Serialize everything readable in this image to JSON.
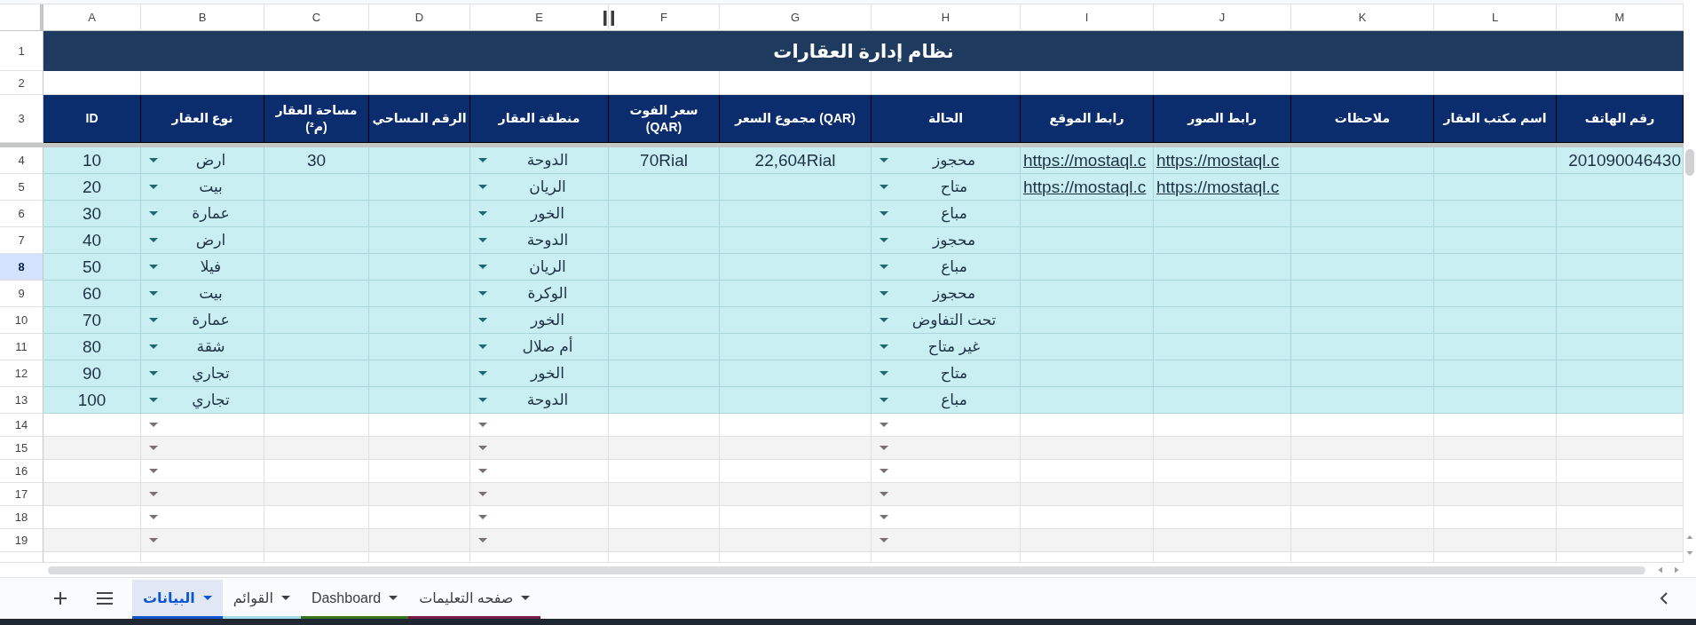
{
  "columns": [
    {
      "letter": "M",
      "kind": "phone",
      "heading": "رقم الهاتف"
    },
    {
      "letter": "L",
      "kind": "text",
      "heading": "اسم مكتب العقار"
    },
    {
      "letter": "K",
      "kind": "text",
      "heading": "ملاحظات"
    },
    {
      "letter": "J",
      "kind": "link",
      "heading": "رابط الصور"
    },
    {
      "letter": "I",
      "kind": "link",
      "heading": "رابط الموقع"
    },
    {
      "letter": "H",
      "kind": "dropdown",
      "heading": "الحالة"
    },
    {
      "letter": "G",
      "kind": "text",
      "heading": "مجموع السعر (QAR)"
    },
    {
      "letter": "F",
      "kind": "text",
      "heading": "سعر الفوت (QAR)"
    },
    {
      "letter": "E",
      "kind": "dropdown",
      "heading": "منطقة العقار"
    },
    {
      "letter": "D",
      "kind": "text",
      "heading": "الرقم المساحي"
    },
    {
      "letter": "C",
      "kind": "number",
      "heading": "مساحة العقار (م²)"
    },
    {
      "letter": "B",
      "kind": "dropdown",
      "heading": "نوع العقار"
    },
    {
      "letter": "A",
      "kind": "number",
      "heading": "ID"
    }
  ],
  "rows": [
    {
      "number": "1",
      "kind": "title",
      "selected": false,
      "title": "نظام إدارة العقارات"
    },
    {
      "number": "2",
      "kind": "spacer",
      "selected": false
    },
    {
      "number": "3",
      "kind": "header",
      "selected": false
    },
    {
      "number": "4",
      "kind": "data",
      "selected": false,
      "values": {
        "id": "10",
        "type": "ارض",
        "area": "30",
        "region": "الدوحة",
        "foot_price": "70Rial",
        "total_price": "22,604Rial",
        "status": "محجوز",
        "site_link": "https://mostaql.c",
        "photos_link": "https://mostaql.c",
        "phone": "201090046430"
      }
    },
    {
      "number": "5",
      "kind": "data",
      "selected": false,
      "values": {
        "id": "20",
        "type": "بيت",
        "region": "الريان",
        "status": "متاح",
        "site_link": "https://mostaql.c",
        "photos_link": "https://mostaql.c"
      }
    },
    {
      "number": "6",
      "kind": "data",
      "selected": false,
      "values": {
        "id": "30",
        "type": "عمارة",
        "region": "الخور",
        "status": "مباع"
      }
    },
    {
      "number": "7",
      "kind": "data",
      "selected": false,
      "values": {
        "id": "40",
        "type": "ارض",
        "region": "الدوحة",
        "status": "محجوز"
      }
    },
    {
      "number": "8",
      "kind": "data",
      "selected": true,
      "values": {
        "id": "50",
        "type": "فيلا",
        "region": "الريان",
        "status": "مباع"
      }
    },
    {
      "number": "9",
      "kind": "data",
      "selected": false,
      "values": {
        "id": "60",
        "type": "بيت",
        "region": "الوكرة",
        "status": "محجوز"
      }
    },
    {
      "number": "10",
      "kind": "data",
      "selected": false,
      "values": {
        "id": "70",
        "type": "عمارة",
        "region": "الخور",
        "status": "تحت التفاوض"
      }
    },
    {
      "number": "11",
      "kind": "data",
      "selected": false,
      "values": {
        "id": "80",
        "type": "شقة",
        "region": "أم صلال",
        "status": "غير متاح"
      }
    },
    {
      "number": "12",
      "kind": "data",
      "selected": false,
      "values": {
        "id": "90",
        "type": "تجاري",
        "region": "الخور",
        "status": "متاح"
      }
    },
    {
      "number": "13",
      "kind": "data",
      "selected": false,
      "values": {
        "id": "100",
        "type": "تجاري",
        "region": "الدوحة",
        "status": "مباع"
      }
    },
    {
      "number": "14",
      "kind": "blank",
      "selected": false
    },
    {
      "number": "15",
      "kind": "blank",
      "selected": false
    },
    {
      "number": "16",
      "kind": "blank",
      "selected": false
    },
    {
      "number": "17",
      "kind": "blank",
      "selected": false
    },
    {
      "number": "18",
      "kind": "blank",
      "selected": false
    },
    {
      "number": "19",
      "kind": "blank",
      "selected": false
    }
  ],
  "sheet_tabs": [
    {
      "label": "صفحه التعليمات",
      "selected": false,
      "color": "#741b47"
    },
    {
      "label": "Dashboard",
      "selected": false,
      "color": "#38761d"
    },
    {
      "label": "القوائم",
      "selected": false,
      "color": "#a4dbe8"
    },
    {
      "label": "البيانات",
      "selected": true,
      "color": "#1155cc"
    }
  ]
}
